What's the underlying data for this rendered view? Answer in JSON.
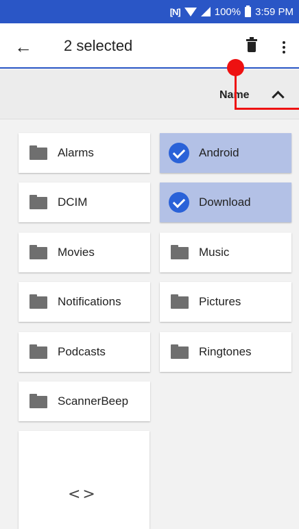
{
  "status_bar": {
    "nfc": "[N]",
    "battery": "100%",
    "time": "3:59 PM"
  },
  "app_bar": {
    "back_icon": "arrow-back-icon",
    "title": "2 selected",
    "delete_icon": "trash-icon",
    "more_icon": "more-vert-icon"
  },
  "sort_bar": {
    "label": "Name",
    "direction": "ascending",
    "direction_icon": "chevron-up-icon"
  },
  "folders": [
    {
      "name": "Alarms",
      "selected": false
    },
    {
      "name": "Android",
      "selected": true
    },
    {
      "name": "DCIM",
      "selected": false
    },
    {
      "name": "Download",
      "selected": true
    },
    {
      "name": "Movies",
      "selected": false
    },
    {
      "name": "Music",
      "selected": false
    },
    {
      "name": "Notifications",
      "selected": false
    },
    {
      "name": "Pictures",
      "selected": false
    },
    {
      "name": "Podcasts",
      "selected": false
    },
    {
      "name": "Ringtones",
      "selected": false
    },
    {
      "name": "ScannerBeep",
      "selected": false
    }
  ],
  "preview": {
    "icon": "code-icon",
    "glyph": "<>"
  },
  "colors": {
    "primary": "#2a56c6",
    "selected_card": "#b3c1e6",
    "check": "#2a62d8",
    "overlay_marker": "#e11111"
  }
}
